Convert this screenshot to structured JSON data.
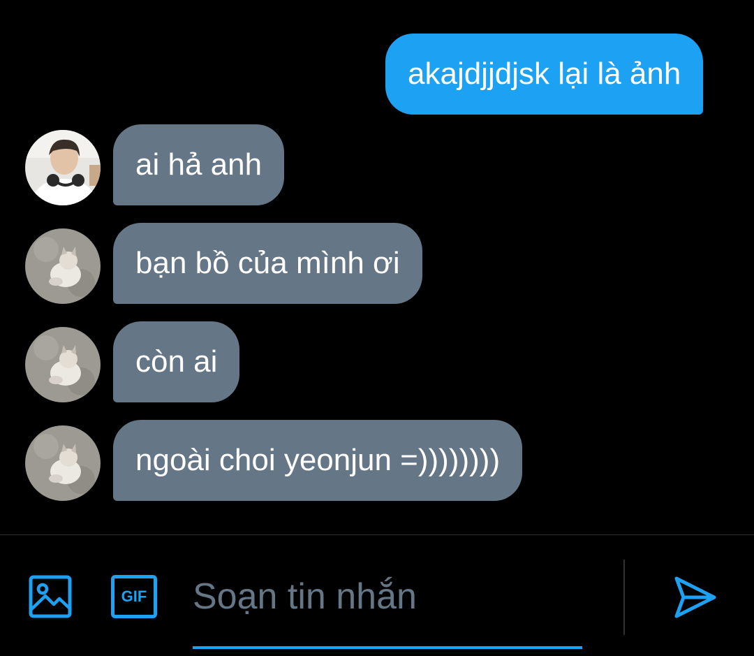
{
  "messages": [
    {
      "direction": "outgoing",
      "text": "akajdjjdjsk lại là ảnh"
    },
    {
      "direction": "incoming",
      "text": "ai hả anh",
      "avatar": "person-avatar"
    },
    {
      "direction": "incoming",
      "text": "bạn bồ của mình ơi",
      "avatar": "cat-avatar"
    },
    {
      "direction": "incoming",
      "text": "còn ai",
      "avatar": "cat-avatar"
    },
    {
      "direction": "incoming",
      "text": "ngoài choi yeonjun =))))))))",
      "avatar": "cat-avatar"
    }
  ],
  "composer": {
    "placeholder": "Soạn tin nhắn",
    "value": "",
    "image_icon": "image-icon",
    "gif_label": "GIF",
    "send_icon": "send-icon"
  },
  "colors": {
    "background": "#000000",
    "outgoing_bubble": "#1da1f2",
    "incoming_bubble": "#657786",
    "accent": "#1da1f2",
    "placeholder": "#657786"
  }
}
